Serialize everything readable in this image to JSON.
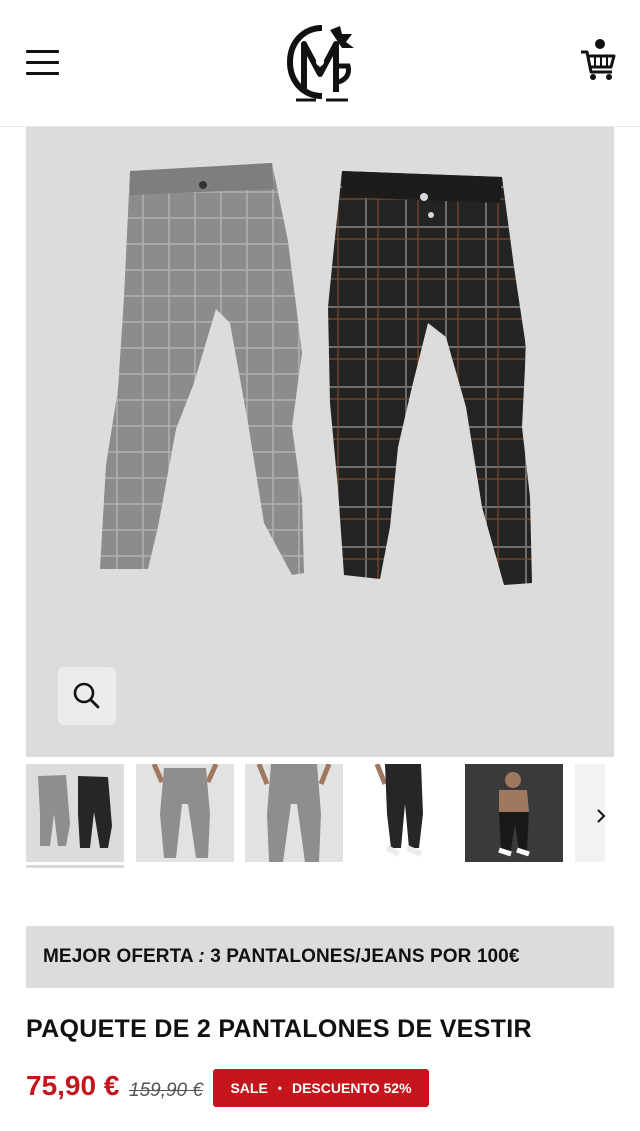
{
  "header": {
    "menu_icon": "hamburger-menu-icon",
    "logo_icon": "brand-monogram-logo",
    "cart_icon": "shopping-cart-icon"
  },
  "gallery": {
    "zoom_icon": "magnifier-icon",
    "next_icon": "chevron-right-icon",
    "thumbnails": [
      "thumbnail-1",
      "thumbnail-2",
      "thumbnail-3",
      "thumbnail-4",
      "thumbnail-5",
      "thumbnail-6"
    ],
    "active_thumbnail": 1
  },
  "promo": {
    "text_before": "MEJOR OFERTA ",
    "text_italic": ":",
    "text_after": " 3 PANTALONES/JEANS POR 100€"
  },
  "product": {
    "title": "PAQUETE DE 2 PANTALONES DE VESTIR",
    "price": "75,90 €",
    "old_price": "159,90 €",
    "badge_sale": "SALE",
    "badge_separator": "•",
    "badge_discount": "DESCUENTO 52%"
  },
  "colors": {
    "sale_red": "#c4161c",
    "panel_gray": "#dcdcdc",
    "grey_trousers": "#8e8e8e",
    "black_trousers": "#262626"
  }
}
